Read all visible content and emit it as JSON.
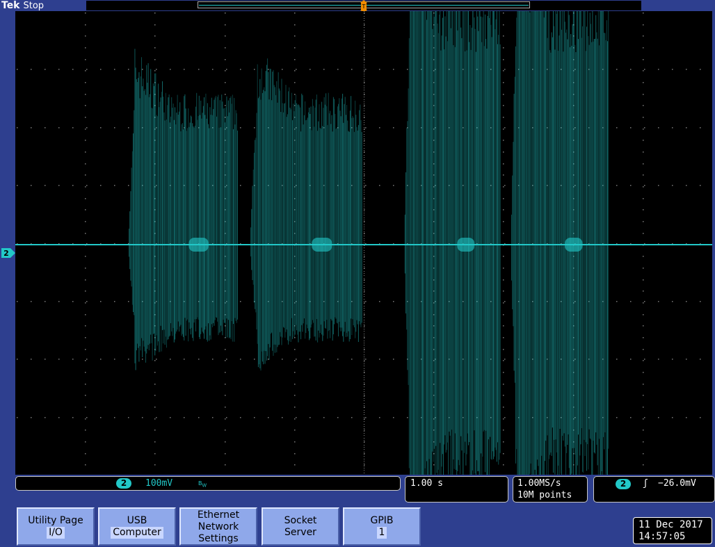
{
  "header": {
    "brand": "Tek",
    "acq_state": "Stop"
  },
  "channel": {
    "badge": "2",
    "scale": "100mV",
    "bandwidth_icon": "B_W",
    "color": "#22c8c8"
  },
  "timebase": {
    "scale": "1.00 s"
  },
  "sampling": {
    "rate": "1.00MS/s",
    "record_length": "10M points"
  },
  "trigger": {
    "source_badge": "2",
    "slope_icon": "rising-edge-icon",
    "slope_glyph": "ʃ",
    "level": "−26.0mV",
    "position_marker_glyph": "T",
    "marker_color": "#f08c00"
  },
  "menu": [
    {
      "line1": "Utility Page",
      "line2": "I/O"
    },
    {
      "line1": "USB",
      "line2": "Computer"
    },
    {
      "line1": "Ethernet",
      "line2": "Network",
      "line3": "Settings"
    },
    {
      "line1": "Socket",
      "line2": "Server"
    },
    {
      "line1": "GPIB",
      "line2": "1"
    }
  ],
  "datetime": {
    "date": "11 Dec 2017",
    "time": "14:57:05"
  },
  "waveform": {
    "description_note": "",
    "bursts": [
      {
        "start": 0.162,
        "end": 0.498,
        "peak_plus": 2.4,
        "peak_minus": 1.55
      },
      {
        "start": 0.558,
        "end": 0.852,
        "peak_plus": 4.1,
        "peak_minus": 3.9
      }
    ]
  }
}
